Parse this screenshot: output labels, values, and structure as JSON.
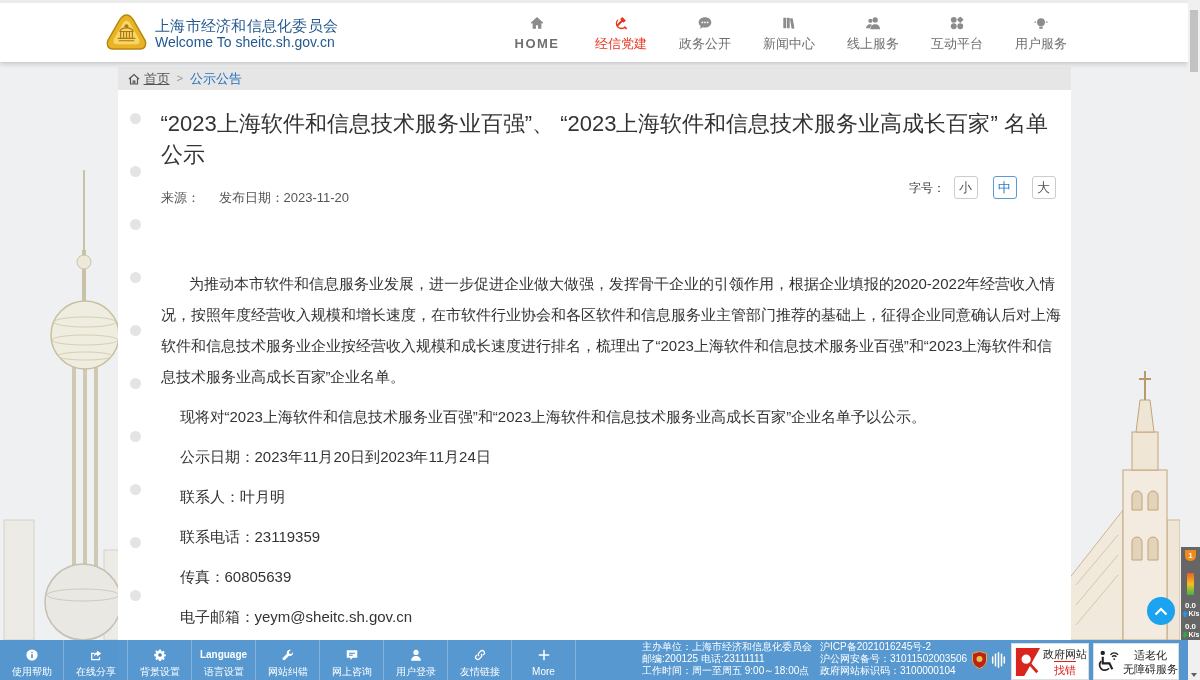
{
  "header": {
    "title": "上海市经济和信息化委员会",
    "subtitle": "Welcome To sheitc.sh.gov.cn"
  },
  "nav": [
    {
      "label": "HOME",
      "selected": false
    },
    {
      "label": "经信党建",
      "selected": true
    },
    {
      "label": "政务公开",
      "selected": false
    },
    {
      "label": "新闻中心",
      "selected": false
    },
    {
      "label": "线上服务",
      "selected": false
    },
    {
      "label": "互动平台",
      "selected": false
    },
    {
      "label": "用户服务",
      "selected": false
    }
  ],
  "breadcrumb": {
    "items": [
      "首页",
      "公示公告"
    ],
    "separator": ">"
  },
  "article": {
    "title": "“2023上海软件和信息技术服务业百强”、 “2023上海软件和信息技术服务业高成长百家” 名单公示",
    "source": "来源：",
    "date": "发布日期：2023-11-20",
    "font_size": {
      "label": "字号：",
      "options": [
        {
          "label": "小",
          "selected": false
        },
        {
          "label": "中",
          "selected": true
        },
        {
          "label": "大",
          "selected": false
        }
      ]
    },
    "paragraphs": [
      {
        "kind": "indented",
        "text": "为推动本市软件和信息服务业发展，进一步促进企业做大做强，发挥骨干企业的引领作用，根据企业填报的2020-2022年经营收入情况，按照年度经营收入规模和增长速度，在市软件行业协会和各区软件和信息服务业主管部门推荐的基础上，征得企业同意确认后对上海软件和信息技术服务业企业按经营收入规模和成长速度进行排名，梳理出了“2023上海软件和信息技术服务业百强”和“2023上海软件和信息技术服务业高成长百家”企业名单。"
      },
      {
        "kind": "plain",
        "text": "现将对“2023上海软件和信息技术服务业百强”和“2023上海软件和信息技术服务业高成长百家”企业名单予以公示。"
      },
      {
        "kind": "plain",
        "text": "公示日期：2023年11月20日到2023年11月24日"
      },
      {
        "kind": "plain",
        "text": "联系人：叶月明"
      },
      {
        "kind": "plain",
        "text": "联系电话：23119359"
      },
      {
        "kind": "plain",
        "text": "传真：60805639"
      },
      {
        "kind": "plain",
        "text": "电子邮箱：yeym@sheitc.sh.gov.cn"
      }
    ]
  },
  "toolbar": [
    {
      "label": "使用帮助"
    },
    {
      "label": "在线分享"
    },
    {
      "label": "背景设置"
    },
    {
      "caption": "Language",
      "label": "语言设置"
    },
    {
      "label": "网站纠错"
    },
    {
      "label": "网上咨询"
    },
    {
      "label": "用户登录"
    },
    {
      "label": "友情链接"
    },
    {
      "label": "More"
    }
  ],
  "footer": {
    "column_1": [
      "主办单位：上海市经济和信息化委员会",
      "邮编:200125 电话:23111111",
      "工作时间：周一至周五 9:00～18:00点"
    ],
    "column_2": [
      "沪ICP备2021016245号-2",
      "沪公网安备号：31011502003506",
      "政府网站标识码：3100000104"
    ]
  },
  "service_badges": [
    {
      "kind": "error_report",
      "lines": [
        "政府网站",
        "找错"
      ]
    },
    {
      "kind": "accessibility",
      "lines": [
        "适老化",
        "无障碍服务"
      ]
    }
  ],
  "speed_monitor": {
    "badge": "1",
    "rates": [
      {
        "value": "0.0",
        "unit": "K/s",
        "color": "#2196f3"
      },
      {
        "value": "0.0",
        "unit": "K/s",
        "color": "#2eaa4a"
      }
    ]
  }
}
